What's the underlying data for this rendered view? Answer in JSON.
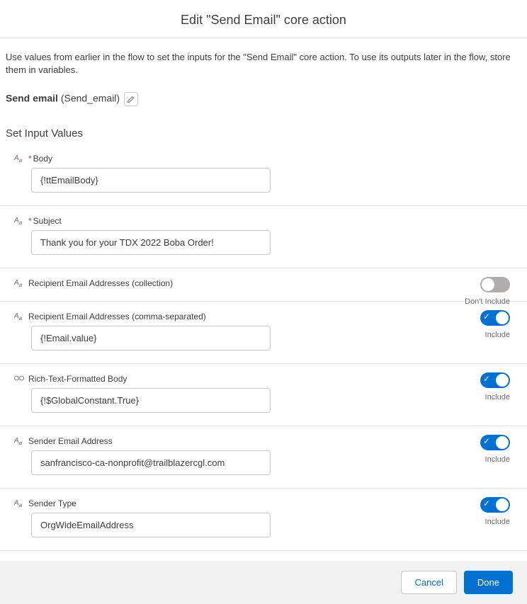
{
  "dialog": {
    "title": "Edit \"Send Email\" core action",
    "intro": "Use values from earlier in the flow to set the inputs for the \"Send Email\" core action. To use its outputs later in the flow, store them in variables.",
    "action_label": "Send email",
    "action_api": "(Send_email)"
  },
  "section_heading": "Set Input Values",
  "toggle_labels": {
    "include": "Include",
    "dont_include": "Don't Include"
  },
  "fields": {
    "body": {
      "label": "Body",
      "required": true,
      "type": "text",
      "value": "{!ttEmailBody}"
    },
    "subject": {
      "label": "Subject",
      "required": true,
      "type": "text",
      "value": "Thank you for your TDX 2022 Boba Order!"
    },
    "recipient_collection": {
      "label": "Recipient Email Addresses (collection)",
      "type": "text",
      "included": false
    },
    "recipient_comma": {
      "label": "Recipient Email Addresses (comma-separated)",
      "type": "text",
      "included": true,
      "value": "{!Email.value}"
    },
    "rich_text": {
      "label": "Rich-Text-Formatted Body",
      "type": "boolean",
      "included": true,
      "value": "{!$GlobalConstant.True}"
    },
    "sender_email": {
      "label": "Sender Email Address",
      "type": "text",
      "included": true,
      "value": "sanfrancisco-ca-nonprofit@trailblazercgl.com"
    },
    "sender_type": {
      "label": "Sender Type",
      "type": "text",
      "included": true,
      "value": "OrgWideEmailAddress"
    }
  },
  "footer": {
    "cancel": "Cancel",
    "done": "Done"
  }
}
